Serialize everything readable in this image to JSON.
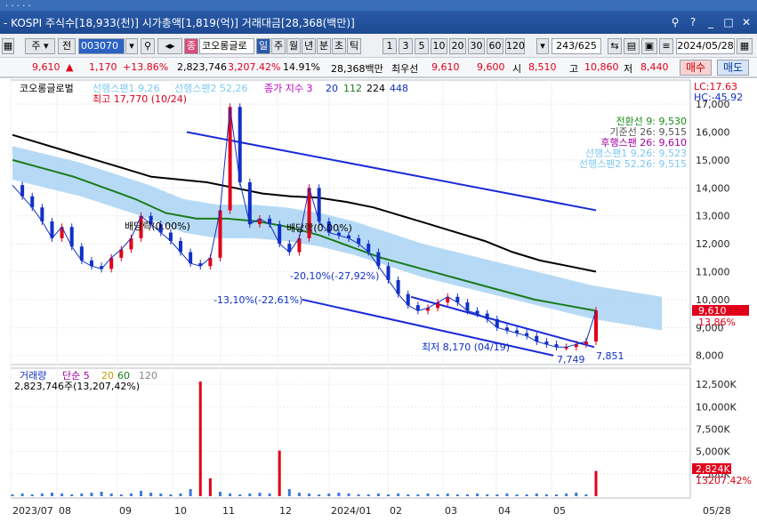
{
  "title": "- KOSPI 주식수[18,933(천)] 시가총액[1,819(억)] 거래대금[28,368(백만)]",
  "toolbar": {
    "ju": "주",
    "jeon": "전",
    "code": "003070",
    "tag": "종",
    "name": "코오롱글로",
    "periods": [
      "일",
      "주",
      "월",
      "년",
      "분",
      "초",
      "틱"
    ],
    "selected_period": "일",
    "nums": [
      "1",
      "3",
      "5",
      "10",
      "20",
      "30",
      "60",
      "120"
    ],
    "count": "243/625",
    "date": "2024/05/28"
  },
  "quote": {
    "price": "9,610",
    "change": "1,170",
    "pct": "+13.86%",
    "volume": "2,823,746",
    "vol_pct": "3,207.42%",
    "turnover": "14.91%",
    "amount": "28,368백만",
    "prefname": "최우선",
    "bid1": "9,610",
    "bid2": "9,600",
    "open_label": "시",
    "open": "8,510",
    "high_label": "고",
    "high": "10,860",
    "low_label": "저",
    "low": "8,440",
    "buy": "매수",
    "sell": "매도"
  },
  "legend": {
    "name": "코오롱글로벌",
    "span1": "선행스팬1 9,26",
    "span2": "선행스팬2 52,26",
    "close": "종가 지수 3",
    "ma20": "20",
    "ma112": "112",
    "ma224": "224",
    "ma448": "448",
    "lc": "LC:17.63",
    "hc": "HC:-45.92"
  },
  "right_labels": {
    "l1": "전환선 9: 9,530",
    "l2": "기준선 26: 9,515",
    "l3": "후행스팬 26: 9,610",
    "l4": "선행스팬1 9,26: 9,523",
    "l5": "선행스팬2 52,26: 9,515"
  },
  "annotations": {
    "high": "최고 17,770 (10/24)",
    "low": "최저 8,170 (04/19)",
    "div1": "배당락(0.00%)",
    "div2": "배당락(0.00%)",
    "fall1": "-20,10%(-27,92%)",
    "fall2": "-13,10%(-22,61%)",
    "p1": "7,749",
    "p2": "7,851",
    "cur_price": "9,610",
    "cur_pct": "13.86%"
  },
  "volume_panel": {
    "legend": "거래량",
    "legend2": "단순 5",
    "legend3": "20",
    "legend4": "60",
    "legend5": "120",
    "info": "2,823,746주(13,207,42%)",
    "cur": "2,824K",
    "cur2": "13207.42%"
  },
  "chart_data": {
    "type": "line",
    "price_axis": [
      "17,000",
      "16,000",
      "15,000",
      "14,000",
      "13,000",
      "12,000",
      "11,000",
      "10,000",
      "9,000",
      "8,000"
    ],
    "volume_axis": [
      "12,500K",
      "10,000K",
      "7,500K",
      "5,000K",
      "2,500K"
    ],
    "x_labels": [
      "2023/07",
      "08",
      "09",
      "10",
      "11",
      "12",
      "2024/01",
      "02",
      "03",
      "04",
      "05",
      "05/28"
    ],
    "ylim": [
      7800,
      17800
    ],
    "close": [
      14100,
      13700,
      13300,
      12800,
      12200,
      12600,
      11900,
      11400,
      11200,
      11100,
      11500,
      11800,
      12200,
      13000,
      12700,
      12400,
      12100,
      11700,
      11300,
      11200,
      11500,
      13200,
      16900,
      14200,
      12700,
      12900,
      12700,
      12000,
      11700,
      12200,
      14000,
      12800,
      12400,
      12300,
      12200,
      12000,
      11700,
      11200,
      10700,
      10200,
      9800,
      9600,
      9700,
      9900,
      10100,
      9900,
      9600,
      9500,
      9300,
      9000,
      8900,
      8800,
      8700,
      8500,
      8400,
      8300,
      8300,
      8400,
      8500,
      9610
    ],
    "ma224": [
      15900,
      15600,
      15300,
      15000,
      14700,
      14400,
      14300,
      14200,
      14000,
      13800,
      13700,
      13650,
      13500,
      13300,
      13000,
      12700,
      12400,
      12100,
      11700,
      11400,
      11200,
      11000
    ],
    "ma112": [
      15000,
      14700,
      14400,
      14000,
      13600,
      13100,
      12900,
      12900,
      12800,
      12600,
      12300,
      11900,
      11500,
      11200,
      10900,
      10600,
      10300,
      10000,
      9800,
      9600
    ],
    "trend_upper": [
      16000,
      13200
    ],
    "channel_upper": [
      10100,
      8300
    ],
    "channel_lower": [
      10000,
      8000
    ],
    "volume": [
      0.2,
      0.3,
      0.2,
      0.3,
      0.4,
      0.3,
      0.2,
      0.3,
      0.4,
      0.5,
      0.3,
      0.2,
      0.3,
      0.6,
      0.4,
      0.3,
      0.2,
      0.3,
      0.8,
      12.8,
      2.0,
      0.5,
      0.3,
      0.2,
      0.3,
      0.4,
      0.3,
      5.1,
      0.8,
      0.4,
      0.3,
      0.2,
      0.3,
      0.4,
      0.3,
      0.2,
      0.2,
      0.3,
      0.2,
      0.3,
      0.2,
      0.2,
      0.3,
      0.2,
      0.3,
      0.2,
      0.2,
      0.3,
      0.2,
      0.2,
      0.3,
      0.2,
      0.2,
      0.3,
      0.2,
      0.2,
      0.3,
      0.4,
      0.2,
      2.82
    ]
  }
}
